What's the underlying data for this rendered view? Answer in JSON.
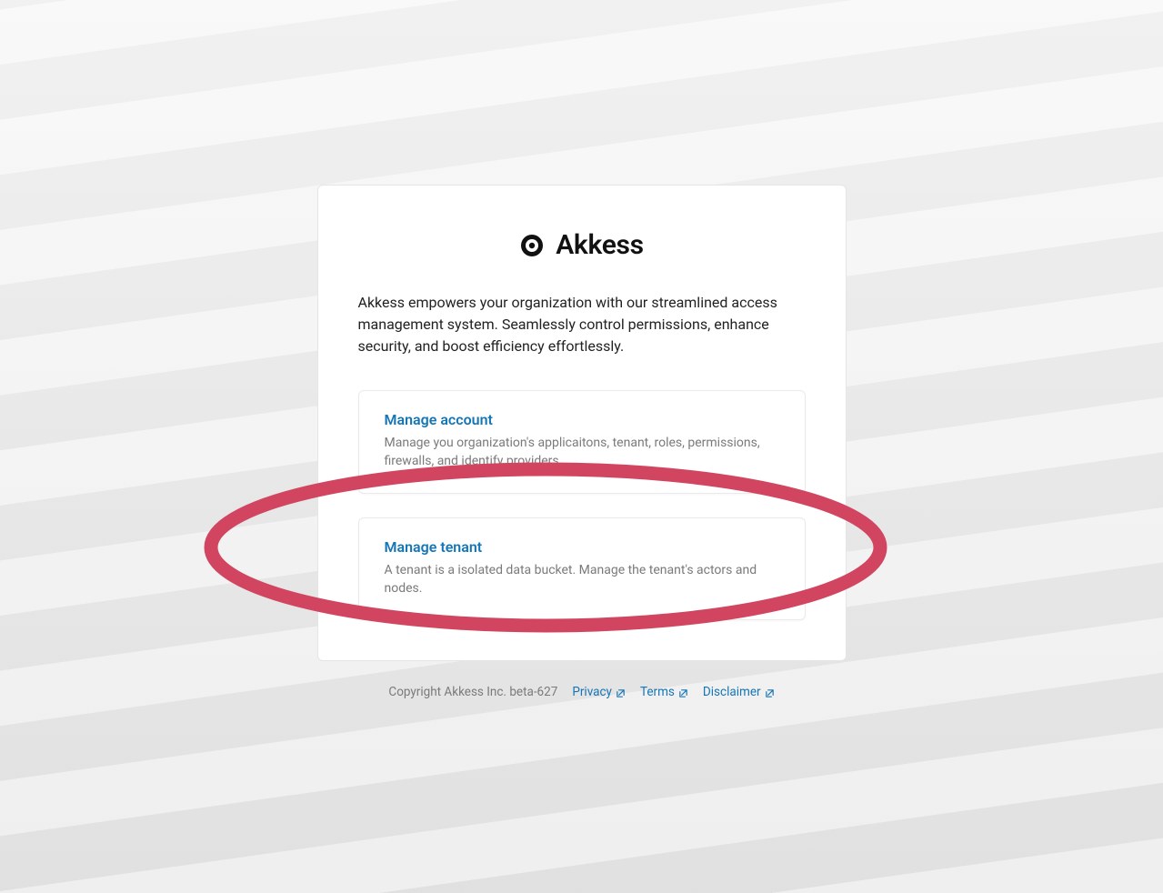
{
  "brand": {
    "name": "Akkess",
    "icon": "target-icon"
  },
  "intro": "Akkess empowers your organization with our streamlined access management system. Seamlessly control permissions, enhance security, and boost efficiency effortlessly.",
  "options": [
    {
      "title": "Manage account",
      "description": "Manage you organization's applicaitons, tenant, roles, permissions, firewalls, and identify providers."
    },
    {
      "title": "Manage tenant",
      "description": "A tenant is a isolated data bucket. Manage the tenant's actors and nodes."
    }
  ],
  "footer": {
    "copyright": "Copyright Akkess Inc. beta-627",
    "links": [
      {
        "label": "Privacy"
      },
      {
        "label": "Terms"
      },
      {
        "label": "Disclaimer"
      }
    ]
  },
  "annotation": {
    "kind": "ellipse-highlight",
    "target": "manage-tenant-card",
    "color": "#d14560"
  }
}
